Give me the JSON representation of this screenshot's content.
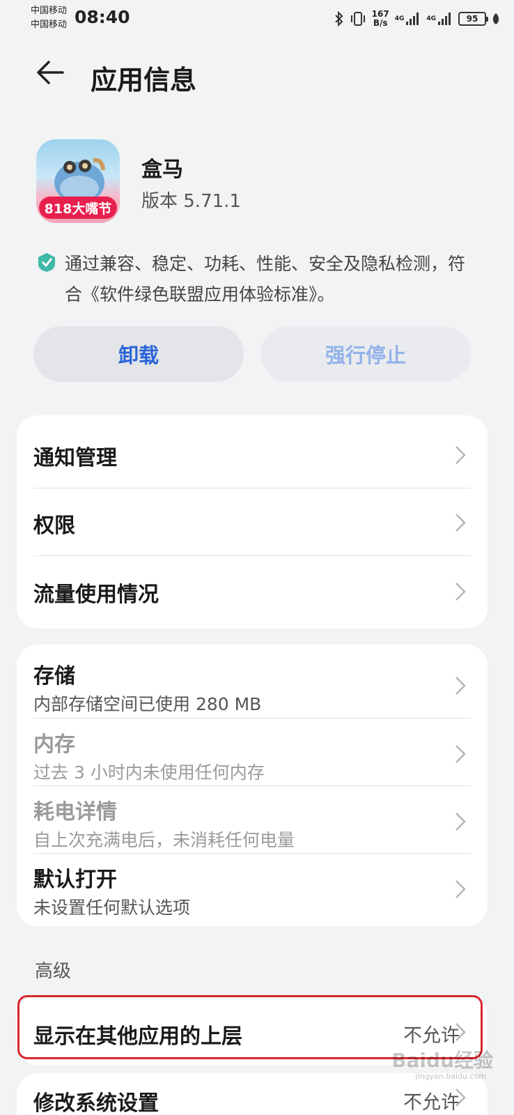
{
  "status_bar": {
    "carrier_1": "中国移动",
    "carrier_2": "中国移动",
    "time": "08:40",
    "speed_value": "167",
    "speed_unit": "B/s",
    "network_1": "4G",
    "network_2": "4G",
    "battery": "95"
  },
  "header": {
    "title": "应用信息"
  },
  "app": {
    "name": "盒马",
    "version": "版本 5.71.1",
    "badge": "818大嘴节"
  },
  "certification": {
    "text": "通过兼容、稳定、功耗、性能、安全及隐私检测，符合《软件绿色联盟应用体验标准》。"
  },
  "actions": {
    "uninstall": "卸载",
    "force_stop": "强行停止"
  },
  "menu_group_1": [
    {
      "title": "通知管理"
    },
    {
      "title": "权限"
    },
    {
      "title": "流量使用情况"
    }
  ],
  "menu_group_2": [
    {
      "title": "存储",
      "subtitle": "内部存储空间已使用 280 MB"
    },
    {
      "title": "内存",
      "subtitle": "过去 3 小时内未使用任何内存"
    },
    {
      "title": "耗电详情",
      "subtitle": "自上次充满电后，未消耗任何电量"
    },
    {
      "title": "默认打开",
      "subtitle": "未设置任何默认选项"
    }
  ],
  "advanced": {
    "label": "高级",
    "items": [
      {
        "title": "显示在其他应用的上层",
        "value": "不允许"
      },
      {
        "title": "修改系统设置",
        "value": "不允许"
      }
    ]
  },
  "watermark": {
    "main": "Baidu经验",
    "sub": "jingyan.baidu.com"
  },
  "colors": {
    "accent": "#2a64d8",
    "highlight_border": "#d9262c",
    "background": "#f1f3f5"
  }
}
